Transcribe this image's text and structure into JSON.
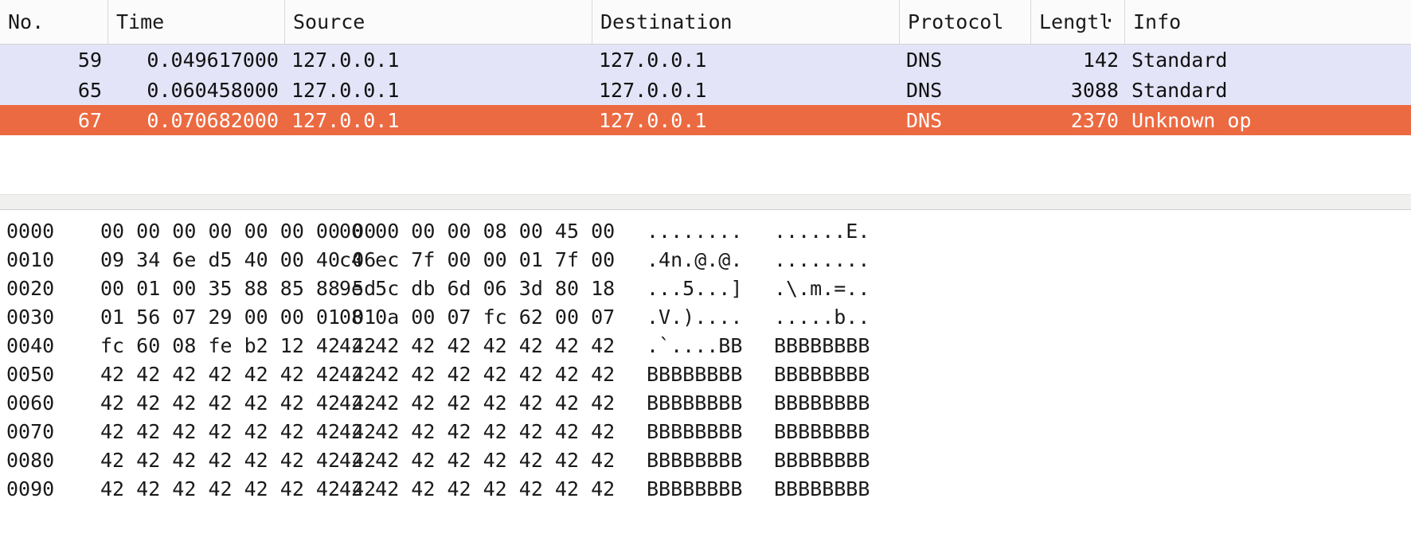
{
  "packet_list": {
    "columns": [
      {
        "key": "no",
        "label": "No.",
        "align": "right"
      },
      {
        "key": "time",
        "label": "Time",
        "align": "right"
      },
      {
        "key": "source",
        "label": "Source",
        "align": "left"
      },
      {
        "key": "dest",
        "label": "Destination",
        "align": "left"
      },
      {
        "key": "protocol",
        "label": "Protocol",
        "align": "left"
      },
      {
        "key": "length",
        "label": "Lengtŀ",
        "align": "right"
      },
      {
        "key": "info",
        "label": "Info",
        "align": "left"
      }
    ],
    "rows": [
      {
        "no": "59",
        "time": "0.049617000",
        "source": "127.0.0.1",
        "dest": "127.0.0.1",
        "protocol": "DNS",
        "length": "142",
        "info": "Standard",
        "selected": false
      },
      {
        "no": "65",
        "time": "0.060458000",
        "source": "127.0.0.1",
        "dest": "127.0.0.1",
        "protocol": "DNS",
        "length": "3088",
        "info": "Standard",
        "selected": false
      },
      {
        "no": "67",
        "time": "0.070682000",
        "source": "127.0.0.1",
        "dest": "127.0.0.1",
        "protocol": "DNS",
        "length": "2370",
        "info": "Unknown op",
        "selected": true
      }
    ]
  },
  "hex_dump": {
    "lines": [
      {
        "offset": "0000",
        "hex1": "00 00 00 00 00 00 00 00",
        "hex2": "00 00 00 00 08 00 45 00",
        "ascii1": "........",
        "ascii2": "......E."
      },
      {
        "offset": "0010",
        "hex1": "09 34 6e d5 40 00 40 06",
        "hex2": "c4 ec 7f 00 00 01 7f 00",
        "ascii1": ".4n.@.@.",
        "ascii2": "........"
      },
      {
        "offset": "0020",
        "hex1": "00 01 00 35 88 85 88 5d",
        "hex2": "9e 5c db 6d 06 3d 80 18",
        "ascii1": "...5...]",
        "ascii2": ".\\.m.=.."
      },
      {
        "offset": "0030",
        "hex1": "01 56 07 29 00 00 01 01",
        "hex2": "08 0a 00 07 fc 62 00 07",
        "ascii1": ".V.)....",
        "ascii2": ".....b.."
      },
      {
        "offset": "0040",
        "hex1": "fc 60 08 fe b2 12 42 42",
        "hex2": "42 42 42 42 42 42 42 42",
        "ascii1": ".`....BB",
        "ascii2": "BBBBBBBB"
      },
      {
        "offset": "0050",
        "hex1": "42 42 42 42 42 42 42 42",
        "hex2": "42 42 42 42 42 42 42 42",
        "ascii1": "BBBBBBBB",
        "ascii2": "BBBBBBBB"
      },
      {
        "offset": "0060",
        "hex1": "42 42 42 42 42 42 42 42",
        "hex2": "42 42 42 42 42 42 42 42",
        "ascii1": "BBBBBBBB",
        "ascii2": "BBBBBBBB"
      },
      {
        "offset": "0070",
        "hex1": "42 42 42 42 42 42 42 42",
        "hex2": "42 42 42 42 42 42 42 42",
        "ascii1": "BBBBBBBB",
        "ascii2": "BBBBBBBB"
      },
      {
        "offset": "0080",
        "hex1": "42 42 42 42 42 42 42 42",
        "hex2": "42 42 42 42 42 42 42 42",
        "ascii1": "BBBBBBBB",
        "ascii2": "BBBBBBBB"
      },
      {
        "offset": "0090",
        "hex1": "42 42 42 42 42 42 42 42",
        "hex2": "42 42 42 42 42 42 42 42",
        "ascii1": "BBBBBBBB",
        "ascii2": "BBBBBBBB"
      }
    ]
  },
  "colors": {
    "selected_row_bg": "#ec6a41",
    "normal_row_bg": "#e4e4f8",
    "header_bg": "#fbfbfb",
    "text": "#1a1a1a",
    "selected_text": "#ffffff"
  }
}
